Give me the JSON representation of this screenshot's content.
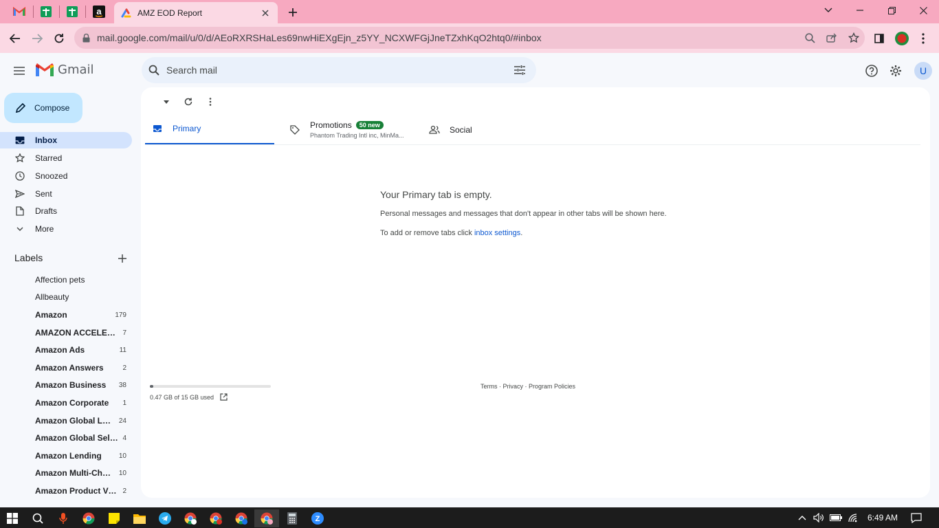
{
  "browser": {
    "active_tab_title": "AMZ EOD Report",
    "url": "mail.google.com/mail/u/0/d/AEoRXRSHaLes69nwHiEXgEjn_z5YY_NCXWFGjJneTZxhKqO2htq0/#inbox"
  },
  "gmail": {
    "logo_text": "Gmail",
    "search_placeholder": "Search mail",
    "avatar_initial": "U"
  },
  "sidebar": {
    "compose_label": "Compose",
    "nav": [
      {
        "label": "Inbox",
        "icon": "inbox-icon",
        "active": true
      },
      {
        "label": "Starred",
        "icon": "star-icon"
      },
      {
        "label": "Snoozed",
        "icon": "clock-icon"
      },
      {
        "label": "Sent",
        "icon": "send-icon"
      },
      {
        "label": "Drafts",
        "icon": "draft-icon"
      },
      {
        "label": "More",
        "icon": "chevron-down-icon"
      }
    ],
    "labels_heading": "Labels",
    "labels": [
      {
        "name": "Affection pets",
        "count": ""
      },
      {
        "name": "Allbeauty",
        "count": ""
      },
      {
        "name": "Amazon",
        "count": "179"
      },
      {
        "name": "AMAZON ACCELERATOR",
        "count": "7"
      },
      {
        "name": "Amazon Ads",
        "count": "11"
      },
      {
        "name": "Amazon Answers",
        "count": "2"
      },
      {
        "name": "Amazon Business",
        "count": "38"
      },
      {
        "name": "Amazon Corporate",
        "count": "1"
      },
      {
        "name": "Amazon Global Logistics",
        "count": "24"
      },
      {
        "name": "Amazon Global Selling",
        "count": "4"
      },
      {
        "name": "Amazon Lending",
        "count": "10"
      },
      {
        "name": "Amazon Multi-Channel",
        "count": "10"
      },
      {
        "name": "Amazon Product Viewer",
        "count": "2"
      }
    ]
  },
  "tabs": {
    "primary": "Primary",
    "promotions": "Promotions",
    "promotions_badge": "50 new",
    "promotions_senders": "Phantom Trading Intl inc, MinMa...",
    "social": "Social"
  },
  "empty_state": {
    "title": "Your Primary tab is empty.",
    "line1": "Personal messages and messages that don't appear in other tabs will be shown here.",
    "line2_prefix": "To add or remove tabs click ",
    "line2_link": "inbox settings",
    "line2_suffix": "."
  },
  "footer": {
    "storage_text": "0.47 GB of 15 GB used",
    "storage_fraction": 0.031,
    "terms": "Terms",
    "privacy": "Privacy",
    "policies": "Program Policies"
  },
  "taskbar": {
    "time": "6:49 AM"
  },
  "colors": {
    "tab_strip": "#f7a9c0",
    "toolbar": "#fbd9e4",
    "compose": "#c2e7ff",
    "active_nav": "#d3e3fd",
    "accent": "#0b57d0",
    "badge": "#188038"
  }
}
